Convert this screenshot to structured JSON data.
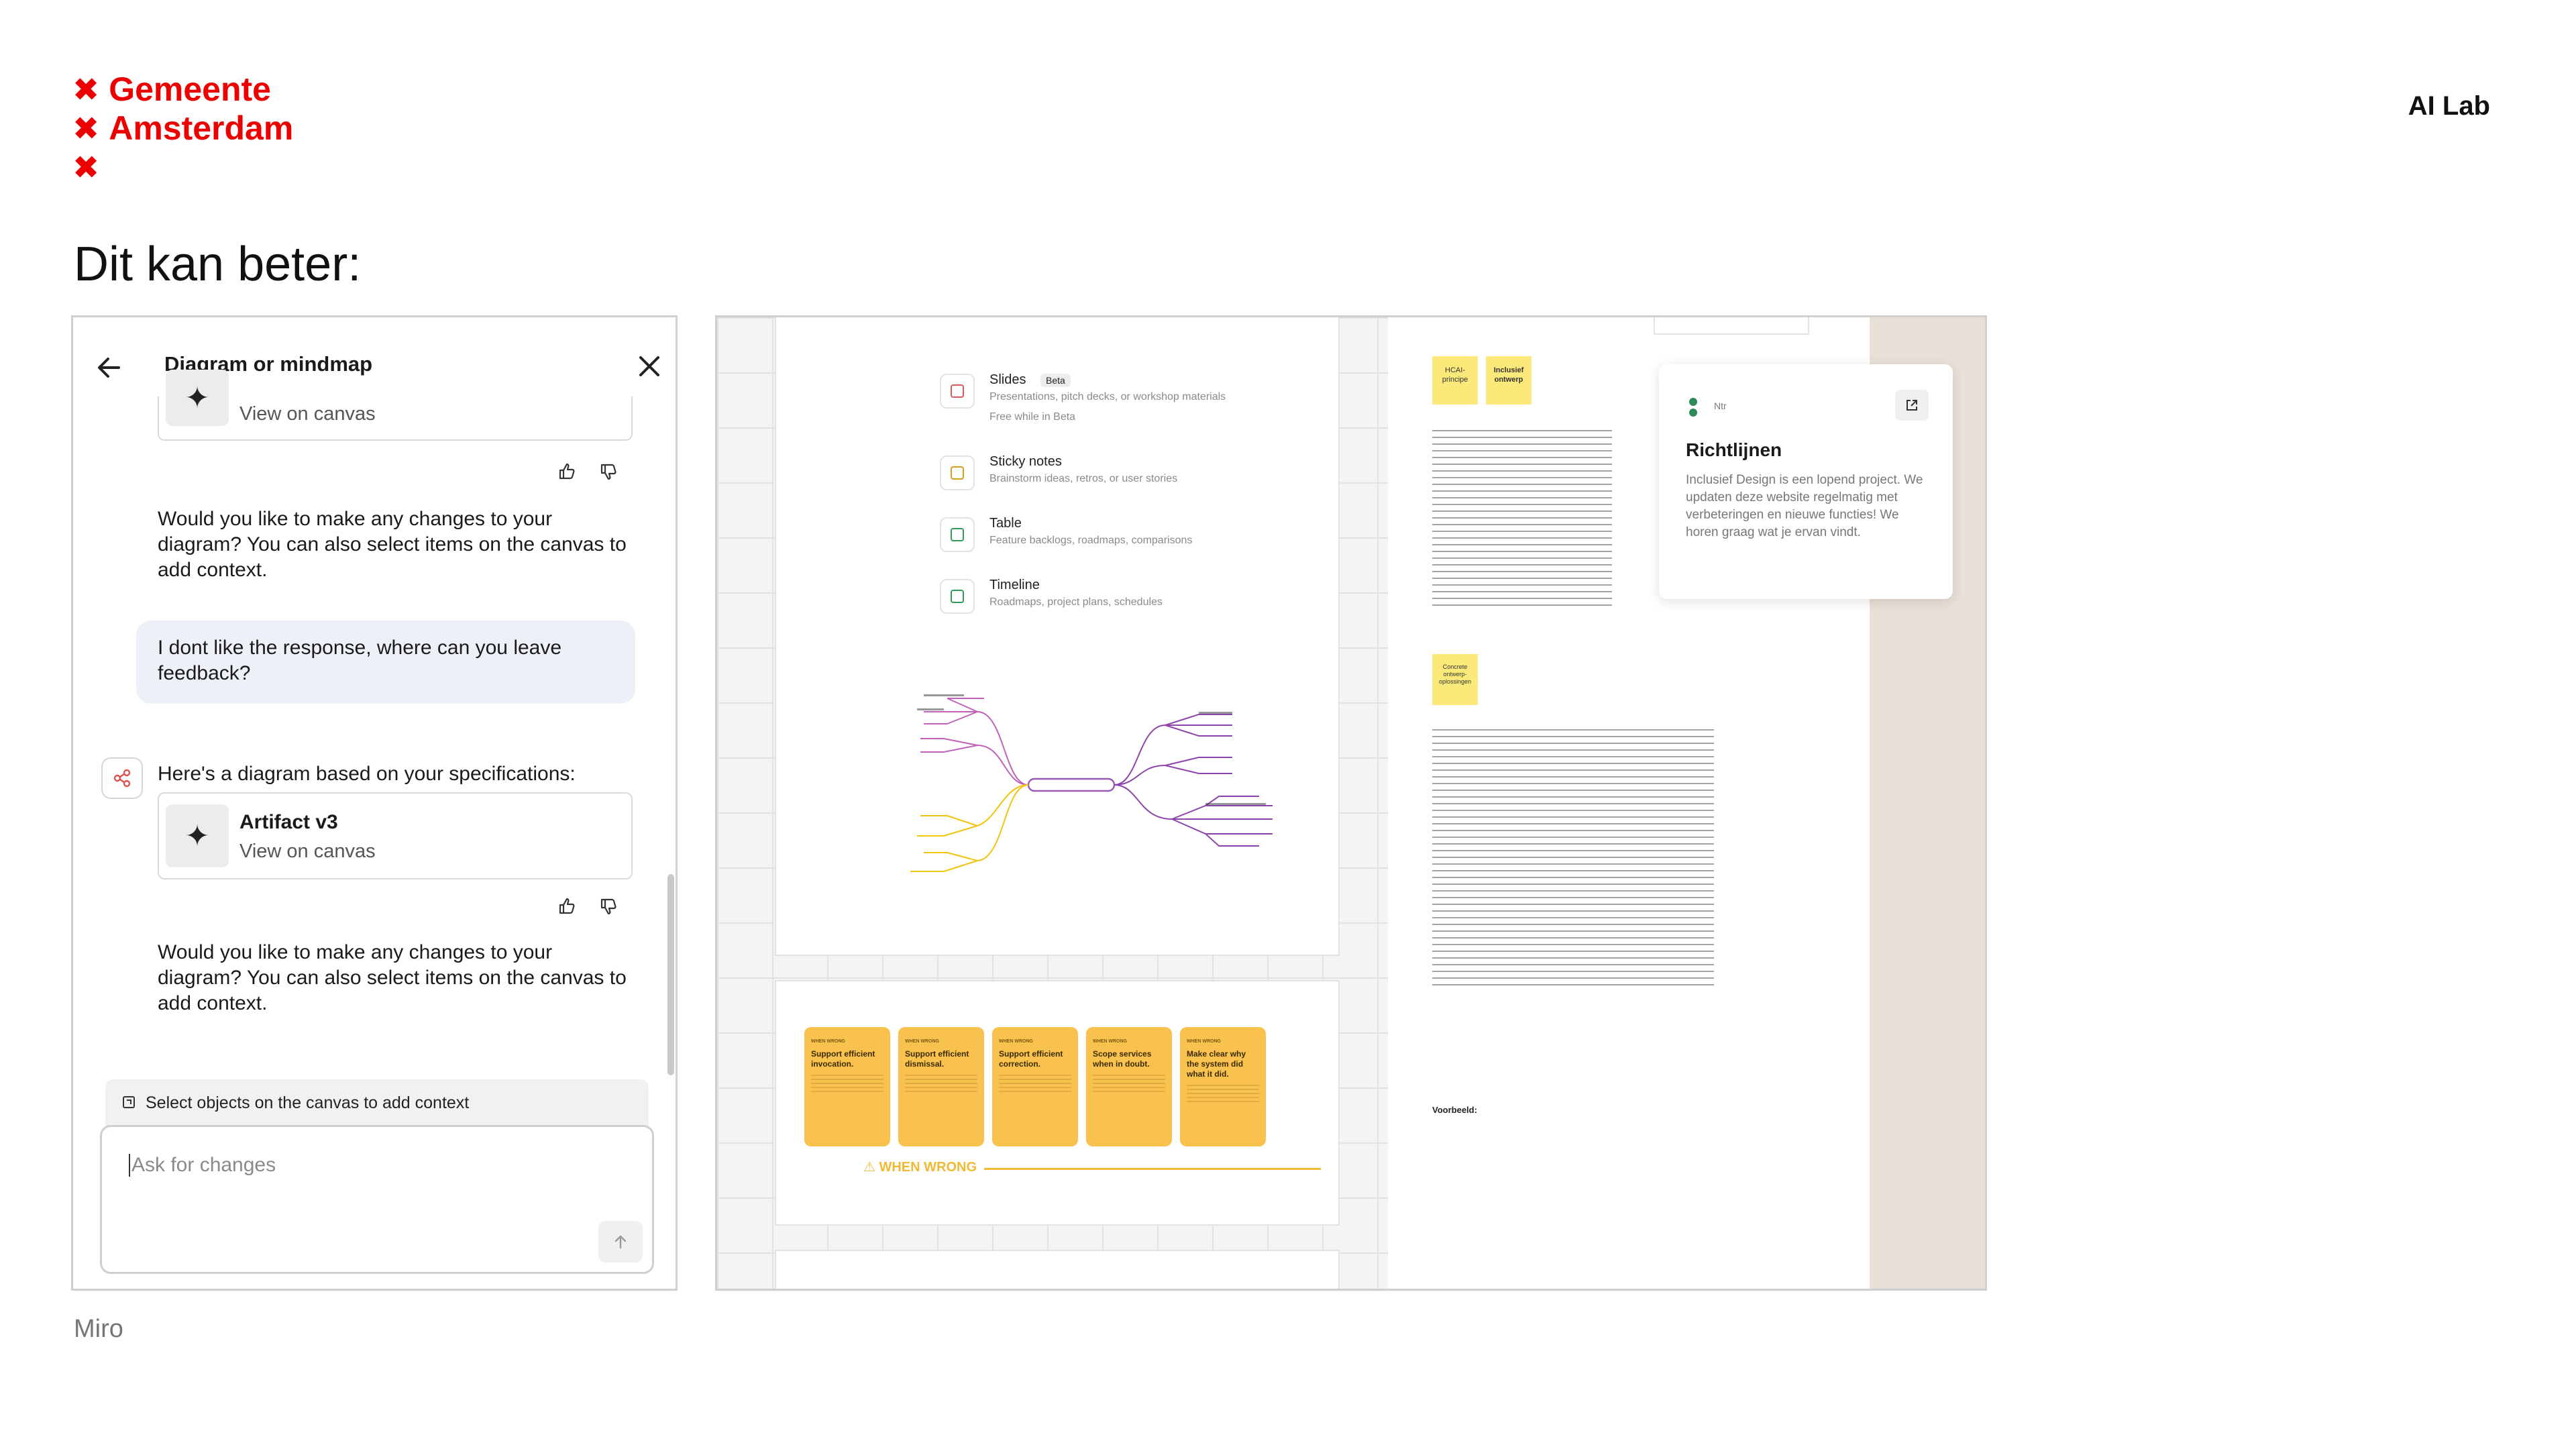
{
  "slide": {
    "logo_line1": "Gemeente",
    "logo_line2": "Amsterdam",
    "brand": "AI Lab",
    "title": "Dit kan beter:",
    "caption": "Miro"
  },
  "chat": {
    "header_title": "Diagram or mindmap",
    "card_top": {
      "link": "View on canvas"
    },
    "question1": "Would you like to make any changes to your diagram? You can also select items on the canvas to add context.",
    "user_message": "I dont like the response, where can you leave feedback?",
    "ai_intro": "Here's a diagram based on your specifications:",
    "card": {
      "title": "Artifact v3",
      "link": "View on canvas"
    },
    "question2": "Would you like to make any changes to your diagram? You can also select items on the canvas to add context.",
    "context_hint": "Select objects on the canvas to add context",
    "input_placeholder": "Ask for changes"
  },
  "canvas": {
    "menu": [
      {
        "title": "Slides",
        "badge": "Beta",
        "desc": "Presentations, pitch decks, or workshop materials",
        "desc2": "Free while in Beta",
        "color": "#e05a5a"
      },
      {
        "title": "Sticky notes",
        "desc": "Brainstorm ideas, retros, or user stories",
        "color": "#d4a017"
      },
      {
        "title": "Table",
        "desc": "Feature backlogs, roadmaps, comparisons",
        "color": "#2e9b57"
      },
      {
        "title": "Timeline",
        "desc": "Roadmaps, project plans, schedules",
        "color": "#2e9b57"
      }
    ],
    "stickies": [
      {
        "tag": "WHEN WRONG",
        "head": "Support efficient invocation."
      },
      {
        "tag": "WHEN WRONG",
        "head": "Support efficient dismissal."
      },
      {
        "tag": "WHEN WRONG",
        "head": "Support efficient correction."
      },
      {
        "tag": "WHEN WRONG",
        "head": "Scope services when in doubt."
      },
      {
        "tag": "WHEN WRONG",
        "head": "Make clear why the system did what it did."
      }
    ],
    "when_wrong": "⚠ WHEN WRONG",
    "doc": {
      "sticky1": "HCAI-principe",
      "sticky2": "Inclusief ontwerp",
      "sticky3": "Concrete ontwerp-oplossingen",
      "voorbeeld": "Voorbeeld:"
    },
    "info_card": {
      "ntr": "Ntr",
      "title": "Richtlijnen",
      "body": "Inclusief Design is een lopend project. We updaten deze website regelmatig met verbeteringen en nieuwe functies! We horen graag wat je ervan vindt."
    }
  },
  "colors": {
    "brand_red": "#ec0000",
    "sticky": "#f9c24e",
    "mindmap_purple": "#9b59b6",
    "mindmap_yellow": "#f1c40f"
  }
}
